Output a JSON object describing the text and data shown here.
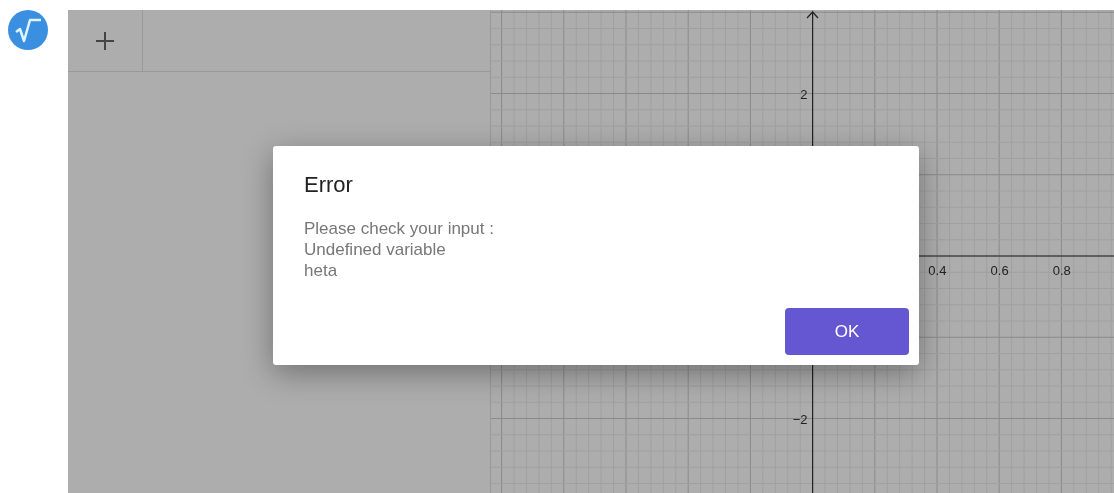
{
  "algebra_panel": {
    "add_button": {
      "kind": "add"
    }
  },
  "graphics": {
    "x_labels": [
      "0.4",
      "0.6",
      "0.8"
    ],
    "y_labels": [
      "2",
      "−2"
    ]
  },
  "dialog": {
    "title": "Error",
    "message": "Please check your input :\nUndefined variable\nheta",
    "buttons": [
      "OK"
    ]
  }
}
